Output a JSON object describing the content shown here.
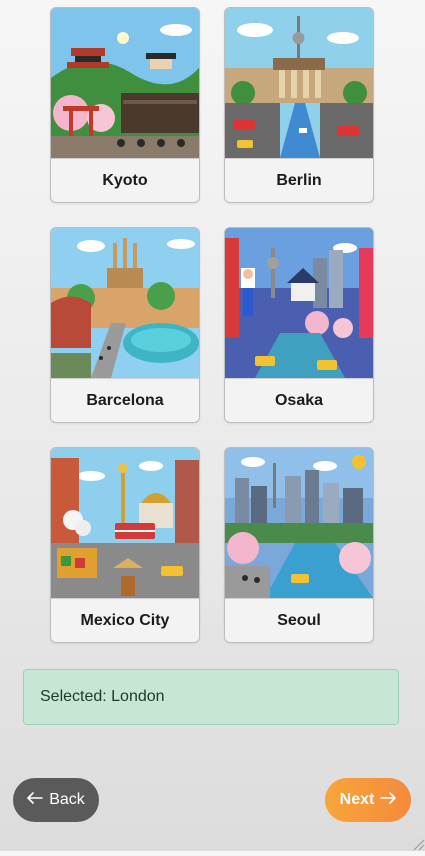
{
  "cities": [
    {
      "name": "Kyoto"
    },
    {
      "name": "Berlin"
    },
    {
      "name": "Barcelona"
    },
    {
      "name": "Osaka"
    },
    {
      "name": "Mexico City"
    },
    {
      "name": "Seoul"
    }
  ],
  "selection": {
    "text": "Selected: London"
  },
  "nav": {
    "back_label": "Back",
    "back_icon": "arrow-left-icon",
    "next_label": "Next",
    "next_icon": "arrow-right-icon"
  },
  "colors": {
    "next_button": "#f59a3b",
    "back_button": "#5a5a5a",
    "selected_bg": "#c8e6d4"
  }
}
